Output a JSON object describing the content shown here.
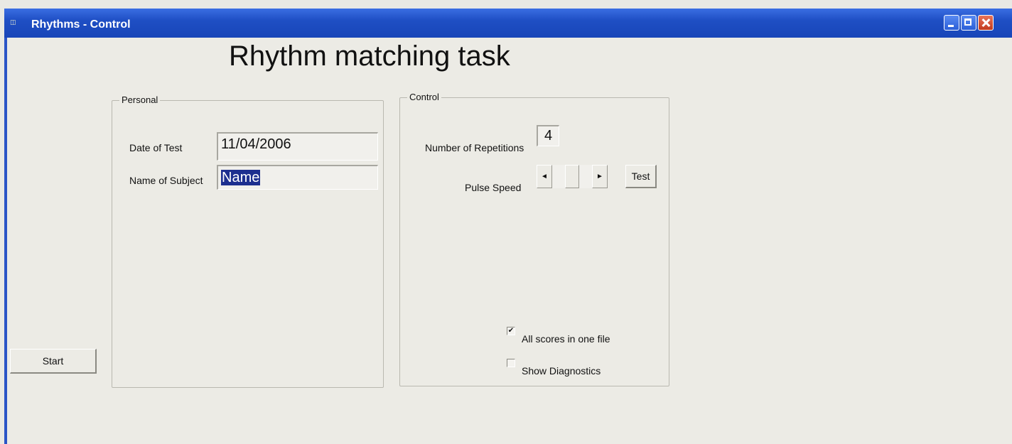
{
  "window": {
    "title": "Rhythms - Control",
    "icon": "app-icon",
    "icon_glyph": "◫"
  },
  "heading": "Rhythm matching task",
  "personal": {
    "legend": "Personal",
    "date_label": "Date of Test",
    "date_value": "11/04/2006",
    "name_label": "Name of Subject",
    "name_value": "Name"
  },
  "control": {
    "legend": "Control",
    "repetitions_label": "Number of Repetitions",
    "repetitions_value": "4",
    "pulse_label": "Pulse Speed",
    "pulse_left_arrow": "◄",
    "pulse_right_arrow": "►",
    "test_label": "Test",
    "all_scores_label": "All scores in one file",
    "all_scores_checked": true,
    "all_scores_mark": "✔",
    "diagnostics_label": "Show Diagnostics",
    "diagnostics_checked": false,
    "diagnostics_mark": ""
  },
  "start_label": "Start",
  "colors": {
    "titlebar": "#1f4fc4",
    "background": "#ecebe5",
    "selection": "#1d2f8f"
  }
}
